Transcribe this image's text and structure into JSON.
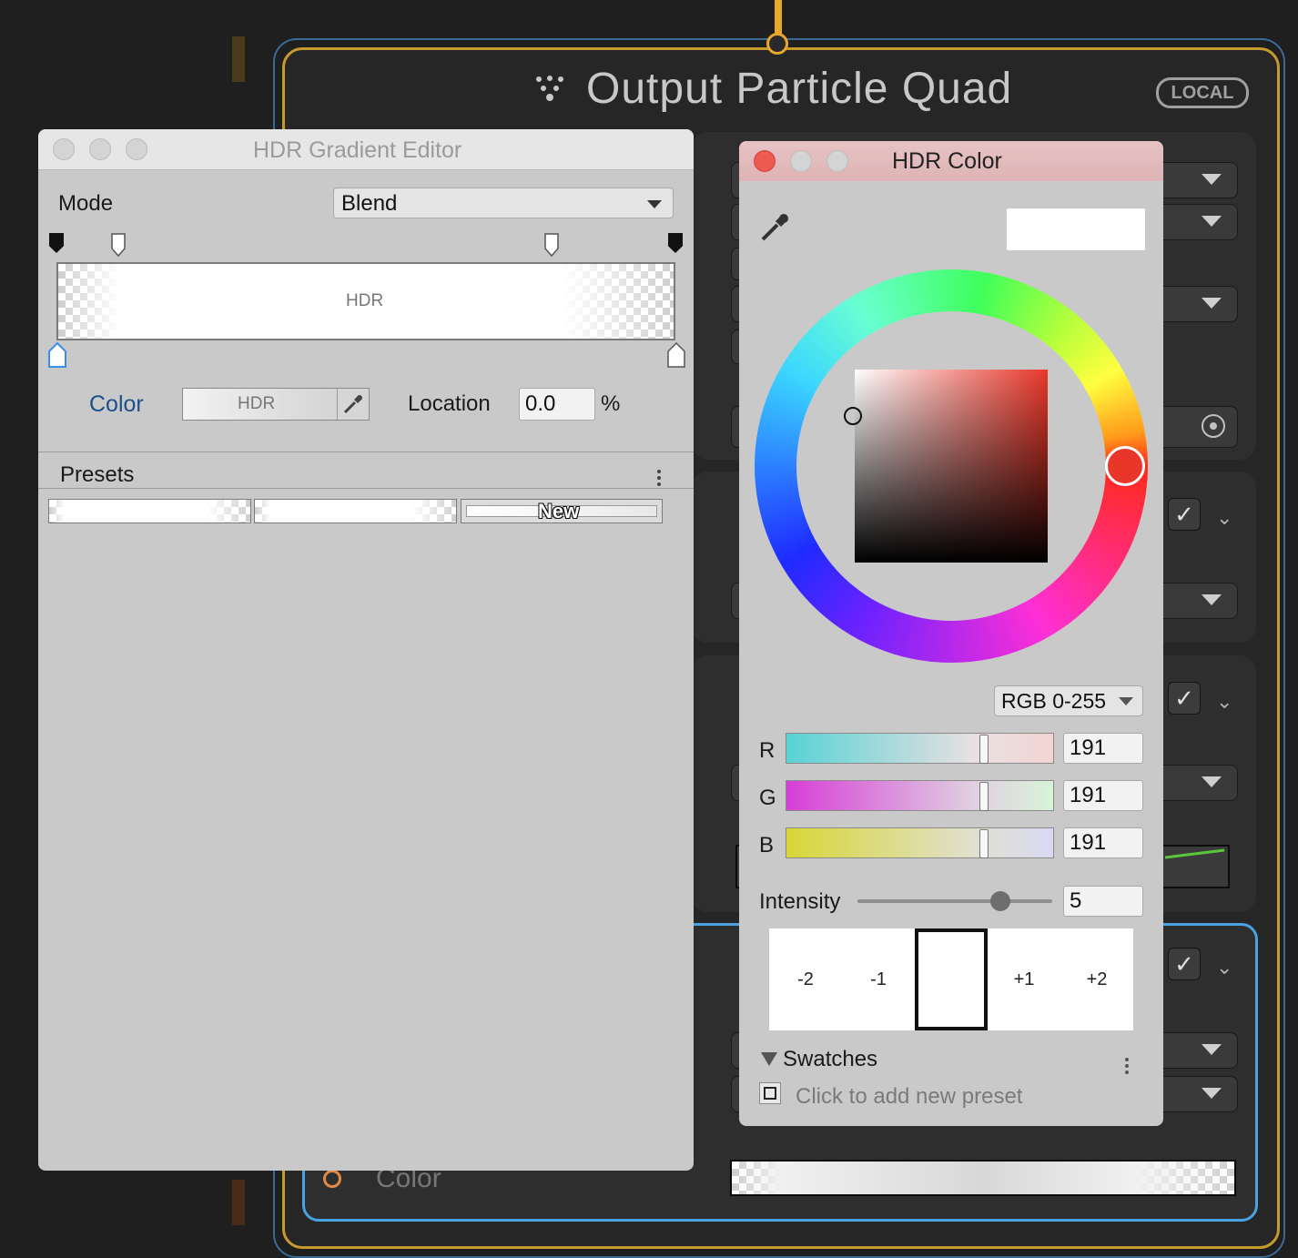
{
  "node": {
    "title": "Output Particle Quad",
    "badge": "LOCAL",
    "color_field_label": "Color",
    "icon": "particle-icon"
  },
  "gradient_editor": {
    "title": "HDR Gradient Editor",
    "mode_label": "Mode",
    "mode_value": "Blend",
    "preview_text": "HDR",
    "color_label": "Color",
    "color_swatch_text": "HDR",
    "location_label": "Location",
    "location_value": "0.0",
    "location_unit": "%",
    "presets_label": "Presets",
    "new_preset_label": "New"
  },
  "hdr_color": {
    "title": "HDR Color",
    "color_mode": "RGB 0-255",
    "channels": [
      {
        "label": "R",
        "value": "191"
      },
      {
        "label": "G",
        "value": "191"
      },
      {
        "label": "B",
        "value": "191"
      }
    ],
    "intensity_label": "Intensity",
    "intensity_value": "5",
    "exposure_steps": [
      "-2",
      "-1",
      "",
      "+1",
      "+2"
    ],
    "swatches_label": "Swatches",
    "add_preset_text": "Click to add new preset"
  },
  "colors": {
    "node_outline_blue": "#3a6b96",
    "node_outline_gold": "#c89a2e",
    "selection_blue": "#4aa3e0",
    "hue_marker": "#e8372a",
    "title_bar_pink": "#e2b9ba"
  }
}
